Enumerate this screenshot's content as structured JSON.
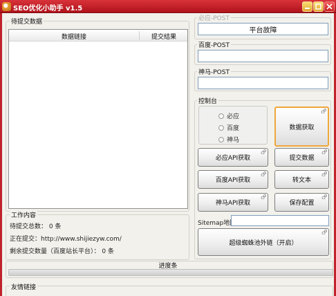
{
  "window": {
    "title": "SEO优化小助手 v1.5"
  },
  "left": {
    "group_title": "待提交数据",
    "columns": [
      "数据链接",
      "提交结果"
    ]
  },
  "bing": {
    "group_title": "必应-POST",
    "value": "平台故障"
  },
  "baidu": {
    "group_title": "百度-POST",
    "value": ""
  },
  "shenma": {
    "group_title": "神马-POST",
    "value": ""
  },
  "console": {
    "group_title": "控制台",
    "radios": [
      "必应",
      "百度",
      "神马"
    ],
    "fetch_data": "数据获取",
    "bing_api": "必应API获取",
    "submit_data": "提交数据",
    "baidu_api": "百度API获取",
    "convert_text": "转文本",
    "shenma_api": "神马API获取",
    "save_config": "保存配置",
    "sitemap_label": "Sitemap地图:",
    "sitemap_value": "",
    "spider_pool": "超级蜘蛛池外链（开启）"
  },
  "work": {
    "group_title": "工作内容",
    "pending_count": "待提交总数： 0 条",
    "submitting": "正在提交：http://www.shijiezyw.com/",
    "remaining": "剩余提交数量（百度站长平台）： 0 条"
  },
  "progress": {
    "label": "进度条",
    "percent": 0
  },
  "links": {
    "group_title": "友情链接"
  },
  "colors": {
    "titlebar": "#c0222a",
    "focus_border": "#f0a63a"
  }
}
